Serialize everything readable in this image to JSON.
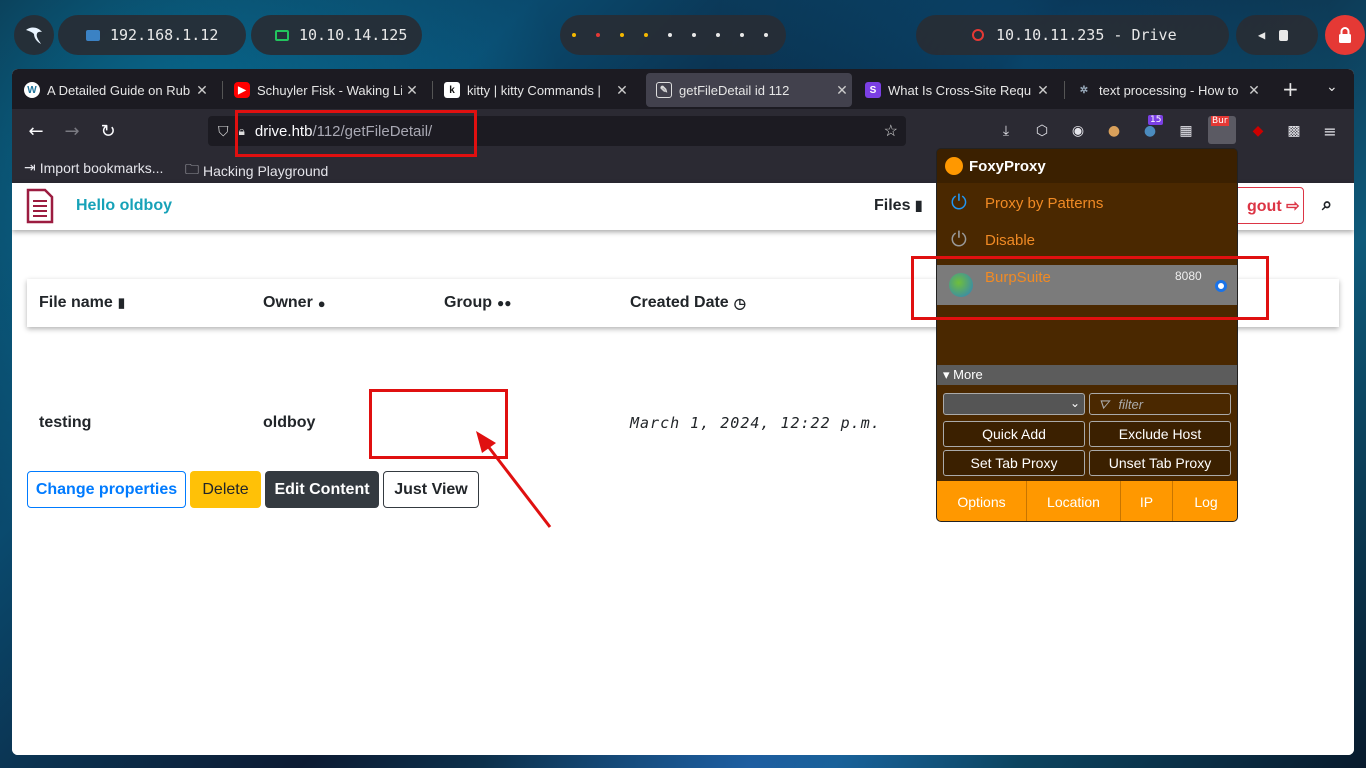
{
  "system_panel": {
    "local_ip": "192.168.1.12",
    "vpn_ip": "10.10.14.125",
    "target": "10.10.11.235 - Drive",
    "workspace_dot_colors": [
      "#f5b800",
      "#e53935",
      "#f5b800",
      "#f5b800",
      "#e8e8e8",
      "#e8e8e8",
      "#e8e8e8",
      "#e8e8e8",
      "#e8e8e8",
      "#e8e8e8"
    ]
  },
  "tabs": [
    {
      "title": "A Detailed Guide on Rub",
      "icon": "wordpress-icon"
    },
    {
      "title": "Schuyler Fisk - Waking Li",
      "icon": "youtube-icon"
    },
    {
      "title": "kitty | kitty Commands |",
      "icon": "kitty-icon"
    },
    {
      "title": "getFileDetail id 112",
      "icon": "document-icon",
      "active": true
    },
    {
      "title": "What Is Cross-Site Requ",
      "icon": "s-icon"
    },
    {
      "title": "text processing - How to",
      "icon": "stackexchange-icon"
    }
  ],
  "urlbar": {
    "host": "drive.htb",
    "path": "/112/getFileDetail/"
  },
  "toolbar": {
    "extension_badge": "15",
    "burp_badge": "Bur"
  },
  "bookmarks": {
    "import": "Import bookmarks...",
    "folder": "Hacking Playground"
  },
  "site": {
    "greeting": "Hello oldboy",
    "files_link": "Files",
    "logout": "gout"
  },
  "table": {
    "headers": [
      "File name",
      "Owner",
      "Group",
      "Created Date"
    ],
    "rows": [
      {
        "file_name": "testing",
        "owner": "oldboy",
        "group": "",
        "created": "March 1, 2024, 12:22 p.m."
      }
    ]
  },
  "actions": {
    "change_properties": "Change properties",
    "delete": "Delete",
    "edit_content": "Edit Content",
    "just_view": "Just View"
  },
  "foxyproxy": {
    "title": "FoxyProxy",
    "proxy_by_patterns": "Proxy by Patterns",
    "disable": "Disable",
    "selected_proxy": "BurpSuite",
    "selected_port": "8080",
    "more": "▾ More",
    "filter_placeholder": "filter",
    "quick_add": "Quick Add",
    "exclude_host": "Exclude Host",
    "set_tab_proxy": "Set Tab Proxy",
    "unset_tab_proxy": "Unset Tab Proxy",
    "footer": [
      "Options",
      "Location",
      "IP",
      "Log"
    ]
  },
  "colors": {
    "annotation": "#e01010",
    "brand_teal": "#17a2b8",
    "foxy_orange": "#ff9800"
  }
}
